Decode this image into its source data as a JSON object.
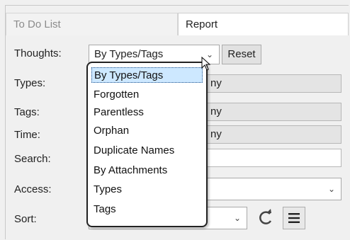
{
  "tabs": {
    "todo": "To Do List",
    "report": "Report"
  },
  "form": {
    "thoughts": {
      "label": "Thoughts:",
      "value": "By Types/Tags",
      "reset_label": "Reset"
    },
    "types": {
      "label": "Types:",
      "value_fragment": "ny"
    },
    "tags": {
      "label": "Tags:",
      "value_fragment": "ny"
    },
    "time": {
      "label": "Time:",
      "value_fragment": "ny"
    },
    "search": {
      "label": "Search:",
      "value": ""
    },
    "access": {
      "label": "Access:"
    },
    "sort": {
      "label": "Sort:"
    }
  },
  "dropdown": {
    "items": [
      "By Types/Tags",
      "Forgotten",
      "Parentless",
      "Orphan",
      "Duplicate Names",
      "By Attachments",
      "Types",
      "Tags"
    ],
    "selected_index": 0
  },
  "icons": {
    "dropdown_arrow": "chevron-down-icon",
    "refresh": "refresh-icon",
    "menu": "hamburger-menu-icon",
    "pointer": "mouse-pointer-icon"
  },
  "colors": {
    "selection_bg": "#cde8ff",
    "accent": "#1a4f8c"
  }
}
